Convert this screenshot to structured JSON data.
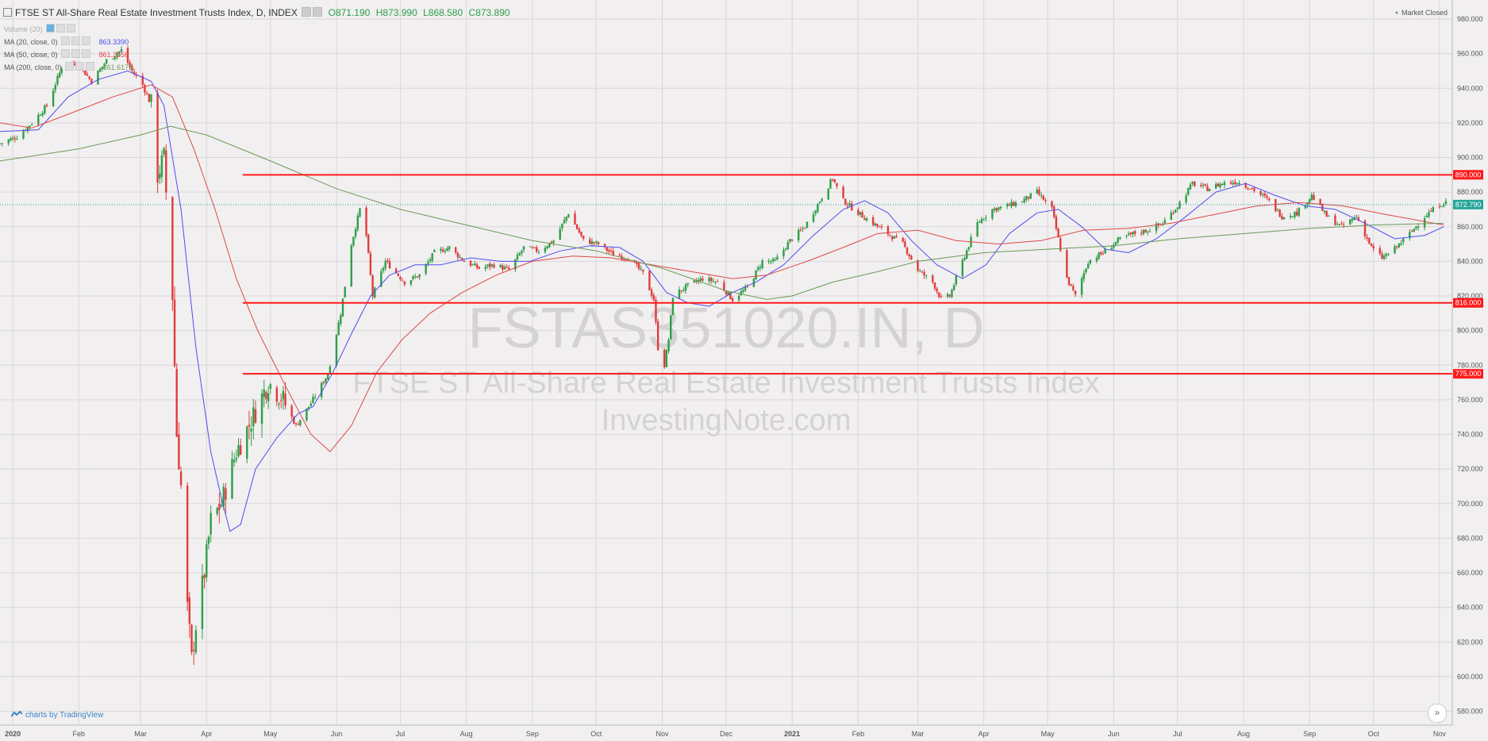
{
  "header": {
    "title": "FTSE ST All-Share Real Estate Investment Trusts Index, D, INDEX",
    "ohlc": [
      {
        "k": "O",
        "v": "871.190"
      },
      {
        "k": "H",
        "v": "873.990"
      },
      {
        "k": "L",
        "v": "868.580"
      },
      {
        "k": "C",
        "v": "873.890"
      }
    ]
  },
  "indicators": [
    {
      "label": "Volume (20)",
      "value": "",
      "color": "#999999"
    },
    {
      "label": "MA (20, close, 0)",
      "value": "863.3390",
      "color": "#4d4df0"
    },
    {
      "label": "MA (50, close, 0)",
      "value": "861.2556",
      "color": "#e04848"
    },
    {
      "label": "MA (200, close, 0)",
      "value": "861.6175",
      "color": "#6b9a56"
    }
  ],
  "status": {
    "market": "Market Closed"
  },
  "watermark": {
    "symbol": "FSTAS351020.IN, D",
    "name": "FTSE ST All-Share Real Estate Investment Trusts Index",
    "site": "InvestingNote.com"
  },
  "branding": {
    "text": "charts by TradingView"
  },
  "nav": {
    "icon": "double-chevron-right-icon",
    "glyph": "»"
  },
  "colors": {
    "up": "#2e9e48",
    "down": "#e03c3c",
    "ma20": "#4d4df0",
    "ma50": "#e04848",
    "ma200": "#6b9a56",
    "hline": "#ff1a1a",
    "last_price": "#26a69a",
    "grid": "#d9d7d8",
    "background": "#f1eff0"
  },
  "chart_data": {
    "type": "candlestick",
    "title": "FTSE ST All-Share Real Estate Investment Trusts Index, D, INDEX",
    "ylim": [
      572,
      991
    ],
    "y_ticks": [
      "980.000",
      "960.000",
      "940.000",
      "920.000",
      "900.000",
      "880.000",
      "860.000",
      "840.000",
      "820.000",
      "800.000",
      "780.000",
      "760.000",
      "740.000",
      "720.000",
      "700.000",
      "680.000",
      "660.000",
      "640.000",
      "620.000",
      "600.000",
      "580.000"
    ],
    "x_labels": [
      "2020",
      "Feb",
      "Mar",
      "Apr",
      "May",
      "Jun",
      "Jul",
      "Aug",
      "Sep",
      "Oct",
      "Nov",
      "Dec",
      "2021",
      "Feb",
      "Mar",
      "Apr",
      "May",
      "Jun",
      "Jul",
      "Aug",
      "Sep",
      "Oct",
      "Nov"
    ],
    "x_label_dates": [
      "2020-01-01",
      "2020-02-01",
      "2020-03-01",
      "2020-04-01",
      "2020-05-01",
      "2020-06-01",
      "2020-07-01",
      "2020-08-01",
      "2020-09-01",
      "2020-10-01",
      "2020-11-01",
      "2020-12-01",
      "2021-01-01",
      "2021-02-01",
      "2021-03-01",
      "2021-04-01",
      "2021-05-01",
      "2021-06-01",
      "2021-07-01",
      "2021-08-01",
      "2021-09-01",
      "2021-10-01",
      "2021-11-01"
    ],
    "x_range": [
      "2019-12-26",
      "2021-11-07"
    ],
    "grid": true,
    "horizontal_lines": [
      {
        "label": "890.000",
        "value": 890,
        "start": "2020-04-18"
      },
      {
        "label": "816.000",
        "value": 816,
        "start": "2020-04-18"
      },
      {
        "label": "775.000",
        "value": 775,
        "start": "2020-04-18"
      }
    ],
    "last_price": {
      "label": "872.790",
      "value": 872.79
    },
    "close_path": [
      [
        "2019-12-26",
        908
      ],
      [
        "2020-01-03",
        912
      ],
      [
        "2020-01-10",
        920
      ],
      [
        "2020-01-17",
        930
      ],
      [
        "2020-01-24",
        952
      ],
      [
        "2020-01-31",
        955
      ],
      [
        "2020-02-07",
        944
      ],
      [
        "2020-02-14",
        956
      ],
      [
        "2020-02-21",
        962
      ],
      [
        "2020-02-26",
        950
      ],
      [
        "2020-03-02",
        942
      ],
      [
        "2020-03-06",
        930
      ],
      [
        "2020-03-09",
        890
      ],
      [
        "2020-03-12",
        900
      ],
      [
        "2020-03-13",
        880
      ],
      [
        "2020-03-16",
        820
      ],
      [
        "2020-03-18",
        740
      ],
      [
        "2020-03-20",
        710
      ],
      [
        "2020-03-23",
        640
      ],
      [
        "2020-03-25",
        610
      ],
      [
        "2020-03-27",
        630
      ],
      [
        "2020-03-31",
        660
      ],
      [
        "2020-04-03",
        690
      ],
      [
        "2020-04-08",
        700
      ],
      [
        "2020-04-15",
        730
      ],
      [
        "2020-04-22",
        748
      ],
      [
        "2020-04-30",
        770
      ],
      [
        "2020-05-06",
        762
      ],
      [
        "2020-05-13",
        745
      ],
      [
        "2020-05-20",
        758
      ],
      [
        "2020-05-28",
        775
      ],
      [
        "2020-06-03",
        810
      ],
      [
        "2020-06-08",
        850
      ],
      [
        "2020-06-12",
        870
      ],
      [
        "2020-06-15",
        855
      ],
      [
        "2020-06-18",
        820
      ],
      [
        "2020-06-24",
        840
      ],
      [
        "2020-07-03",
        828
      ],
      [
        "2020-07-10",
        832
      ],
      [
        "2020-07-17",
        845
      ],
      [
        "2020-07-24",
        848
      ],
      [
        "2020-07-31",
        840
      ],
      [
        "2020-08-07",
        836
      ],
      [
        "2020-08-14",
        838
      ],
      [
        "2020-08-21",
        835
      ],
      [
        "2020-08-28",
        848
      ],
      [
        "2020-09-04",
        846
      ],
      [
        "2020-09-11",
        852
      ],
      [
        "2020-09-18",
        868
      ],
      [
        "2020-09-25",
        852
      ],
      [
        "2020-10-02",
        850
      ],
      [
        "2020-10-09",
        844
      ],
      [
        "2020-10-16",
        842
      ],
      [
        "2020-10-23",
        833
      ],
      [
        "2020-10-28",
        818
      ],
      [
        "2020-10-30",
        790
      ],
      [
        "2020-11-02",
        780
      ],
      [
        "2020-11-04",
        795
      ],
      [
        "2020-11-06",
        820
      ],
      [
        "2020-11-13",
        826
      ],
      [
        "2020-11-20",
        830
      ],
      [
        "2020-11-27",
        828
      ],
      [
        "2020-12-04",
        818
      ],
      [
        "2020-12-11",
        825
      ],
      [
        "2020-12-18",
        840
      ],
      [
        "2020-12-24",
        840
      ],
      [
        "2020-12-31",
        852
      ],
      [
        "2021-01-07",
        860
      ],
      [
        "2021-01-14",
        875
      ],
      [
        "2021-01-20",
        888
      ],
      [
        "2021-01-25",
        875
      ],
      [
        "2021-02-01",
        868
      ],
      [
        "2021-02-08",
        862
      ],
      [
        "2021-02-15",
        856
      ],
      [
        "2021-02-22",
        850
      ],
      [
        "2021-03-01",
        835
      ],
      [
        "2021-03-08",
        828
      ],
      [
        "2021-03-12",
        818
      ],
      [
        "2021-03-16",
        820
      ],
      [
        "2021-03-22",
        840
      ],
      [
        "2021-03-29",
        862
      ],
      [
        "2021-04-05",
        870
      ],
      [
        "2021-04-12",
        872
      ],
      [
        "2021-04-19",
        875
      ],
      [
        "2021-04-26",
        880
      ],
      [
        "2021-05-03",
        870
      ],
      [
        "2021-05-10",
        830
      ],
      [
        "2021-05-14",
        820
      ],
      [
        "2021-05-20",
        840
      ],
      [
        "2021-05-27",
        845
      ],
      [
        "2021-06-03",
        852
      ],
      [
        "2021-06-10",
        856
      ],
      [
        "2021-06-17",
        858
      ],
      [
        "2021-06-24",
        862
      ],
      [
        "2021-07-01",
        872
      ],
      [
        "2021-07-08",
        885
      ],
      [
        "2021-07-15",
        882
      ],
      [
        "2021-07-22",
        885
      ],
      [
        "2021-07-29",
        886
      ],
      [
        "2021-08-05",
        882
      ],
      [
        "2021-08-12",
        876
      ],
      [
        "2021-08-19",
        866
      ],
      [
        "2021-08-26",
        868
      ],
      [
        "2021-09-02",
        878
      ],
      [
        "2021-09-09",
        866
      ],
      [
        "2021-09-16",
        860
      ],
      [
        "2021-09-23",
        866
      ],
      [
        "2021-09-30",
        848
      ],
      [
        "2021-10-05",
        842
      ],
      [
        "2021-10-10",
        846
      ],
      [
        "2021-10-18",
        856
      ],
      [
        "2021-10-25",
        866
      ],
      [
        "2021-11-01",
        872.79
      ],
      [
        "2021-11-03",
        873.89
      ]
    ],
    "ma_series": [
      {
        "name": "MA (20, close, 0)",
        "color": "#4d4df0",
        "points": [
          [
            "2019-12-26",
            915
          ],
          [
            "2020-01-13",
            916
          ],
          [
            "2020-01-27",
            935
          ],
          [
            "2020-02-10",
            945
          ],
          [
            "2020-02-24",
            950
          ],
          [
            "2020-03-06",
            944
          ],
          [
            "2020-03-12",
            930
          ],
          [
            "2020-03-20",
            870
          ],
          [
            "2020-03-27",
            790
          ],
          [
            "2020-04-03",
            730
          ],
          [
            "2020-04-08",
            703
          ],
          [
            "2020-04-12",
            684
          ],
          [
            "2020-04-17",
            688
          ],
          [
            "2020-04-24",
            720
          ],
          [
            "2020-05-04",
            738
          ],
          [
            "2020-05-14",
            752
          ],
          [
            "2020-05-21",
            756
          ],
          [
            "2020-05-30",
            775
          ],
          [
            "2020-06-08",
            798
          ],
          [
            "2020-06-17",
            820
          ],
          [
            "2020-06-26",
            832
          ],
          [
            "2020-07-08",
            838
          ],
          [
            "2020-07-20",
            838
          ],
          [
            "2020-08-03",
            842
          ],
          [
            "2020-08-17",
            840
          ],
          [
            "2020-08-31",
            840
          ],
          [
            "2020-09-14",
            846
          ],
          [
            "2020-09-28",
            849
          ],
          [
            "2020-10-12",
            848
          ],
          [
            "2020-10-23",
            840
          ],
          [
            "2020-11-03",
            822
          ],
          [
            "2020-11-13",
            816
          ],
          [
            "2020-11-23",
            814
          ],
          [
            "2020-12-04",
            822
          ],
          [
            "2020-12-15",
            828
          ],
          [
            "2020-12-28",
            838
          ],
          [
            "2021-01-11",
            855
          ],
          [
            "2021-01-25",
            870
          ],
          [
            "2021-02-04",
            875
          ],
          [
            "2021-02-15",
            868
          ],
          [
            "2021-02-26",
            852
          ],
          [
            "2021-03-10",
            838
          ],
          [
            "2021-03-22",
            830
          ],
          [
            "2021-04-02",
            838
          ],
          [
            "2021-04-13",
            856
          ],
          [
            "2021-04-26",
            868
          ],
          [
            "2021-05-06",
            870
          ],
          [
            "2021-05-17",
            860
          ],
          [
            "2021-05-28",
            847
          ],
          [
            "2021-06-08",
            845
          ],
          [
            "2021-06-21",
            853
          ],
          [
            "2021-07-05",
            866
          ],
          [
            "2021-07-19",
            880
          ],
          [
            "2021-08-02",
            885
          ],
          [
            "2021-08-16",
            878
          ],
          [
            "2021-08-30",
            872
          ],
          [
            "2021-09-13",
            870
          ],
          [
            "2021-09-27",
            862
          ],
          [
            "2021-10-11",
            853
          ],
          [
            "2021-10-25",
            855
          ],
          [
            "2021-11-03",
            860
          ]
        ]
      },
      {
        "name": "MA (50, close, 0)",
        "color": "#e04848",
        "points": [
          [
            "2019-12-26",
            920
          ],
          [
            "2020-01-10",
            917
          ],
          [
            "2020-01-27",
            925
          ],
          [
            "2020-02-17",
            935
          ],
          [
            "2020-03-06",
            942
          ],
          [
            "2020-03-16",
            935
          ],
          [
            "2020-03-26",
            905
          ],
          [
            "2020-04-05",
            870
          ],
          [
            "2020-04-15",
            830
          ],
          [
            "2020-04-25",
            800
          ],
          [
            "2020-05-08",
            768
          ],
          [
            "2020-05-20",
            740
          ],
          [
            "2020-05-29",
            730
          ],
          [
            "2020-06-08",
            745
          ],
          [
            "2020-06-20",
            776
          ],
          [
            "2020-07-02",
            795
          ],
          [
            "2020-07-15",
            810
          ],
          [
            "2020-07-30",
            822
          ],
          [
            "2020-08-15",
            832
          ],
          [
            "2020-09-01",
            840
          ],
          [
            "2020-09-20",
            843
          ],
          [
            "2020-10-08",
            842
          ],
          [
            "2020-10-27",
            838
          ],
          [
            "2020-11-15",
            834
          ],
          [
            "2020-12-04",
            830
          ],
          [
            "2020-12-20",
            832
          ],
          [
            "2021-01-08",
            840
          ],
          [
            "2021-01-25",
            848
          ],
          [
            "2021-02-10",
            856
          ],
          [
            "2021-03-01",
            858
          ],
          [
            "2021-03-19",
            852
          ],
          [
            "2021-04-08",
            850
          ],
          [
            "2021-04-28",
            852
          ],
          [
            "2021-05-18",
            858
          ],
          [
            "2021-06-08",
            859
          ],
          [
            "2021-06-28",
            862
          ],
          [
            "2021-07-18",
            867
          ],
          [
            "2021-08-07",
            872
          ],
          [
            "2021-08-27",
            874
          ],
          [
            "2021-09-17",
            872
          ],
          [
            "2021-10-07",
            867
          ],
          [
            "2021-10-25",
            863
          ],
          [
            "2021-11-03",
            861
          ]
        ]
      },
      {
        "name": "MA (200, close, 0)",
        "color": "#6b9a56",
        "points": [
          [
            "2019-12-26",
            898
          ],
          [
            "2020-02-01",
            905
          ],
          [
            "2020-03-01",
            913
          ],
          [
            "2020-03-15",
            918
          ],
          [
            "2020-04-01",
            913
          ],
          [
            "2020-05-01",
            898
          ],
          [
            "2020-06-01",
            882
          ],
          [
            "2020-07-01",
            870
          ],
          [
            "2020-08-01",
            861
          ],
          [
            "2020-09-01",
            852
          ],
          [
            "2020-10-01",
            846
          ],
          [
            "2020-11-01",
            836
          ],
          [
            "2020-12-01",
            823
          ],
          [
            "2020-12-20",
            818
          ],
          [
            "2021-01-01",
            820
          ],
          [
            "2021-01-20",
            828
          ],
          [
            "2021-02-10",
            834
          ],
          [
            "2021-03-01",
            840
          ],
          [
            "2021-04-01",
            845
          ],
          [
            "2021-05-01",
            847
          ],
          [
            "2021-06-01",
            849
          ],
          [
            "2021-07-01",
            853
          ],
          [
            "2021-08-01",
            856
          ],
          [
            "2021-09-01",
            859
          ],
          [
            "2021-10-01",
            861
          ],
          [
            "2021-11-03",
            862
          ]
        ]
      }
    ]
  }
}
